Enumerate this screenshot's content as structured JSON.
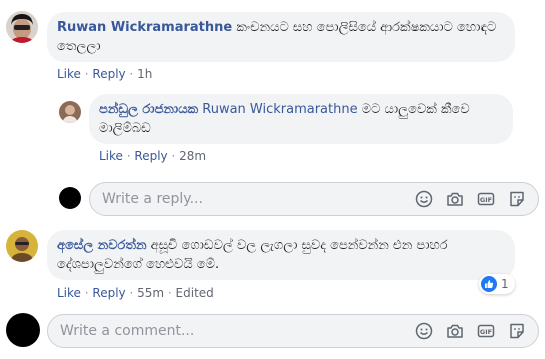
{
  "comments": [
    {
      "author": "Ruwan Wickramarathne",
      "text": "කංචනයට සහ පොලිසියේ ආරක්ෂකයාට හොඳට තෙලලා",
      "like_label": "Like",
      "reply_label": "Reply",
      "time": "1h"
    },
    {
      "author": "පන්ඩුල රාජනායක",
      "mention": "Ruwan Wickramarathne",
      "text": "මට යාලුවෙක් කීවෙ මාලිම්බඩ",
      "like_label": "Like",
      "reply_label": "Reply",
      "time": "28m"
    },
    {
      "author": "අසේල නවරත්න",
      "text": "අසූචි ගොඩවල් වල ලැගලා සුවද පෙන්වන්න එන පාහර දේශපාලුවන්ගේ හෙළුවයි මේ.",
      "like_label": "Like",
      "reply_label": "Reply",
      "time": "55m",
      "edited_label": "Edited",
      "reaction_count": "1"
    }
  ],
  "reply_input": {
    "placeholder": "Write a reply..."
  },
  "comment_input": {
    "placeholder": "Write a comment..."
  },
  "icons": [
    "smiley-icon",
    "camera-icon",
    "gif-icon",
    "sticker-icon",
    "like-reaction-icon"
  ],
  "colors": {
    "link": "#385898",
    "bubble": "#f2f3f5",
    "like_blue": "#2078f4"
  }
}
